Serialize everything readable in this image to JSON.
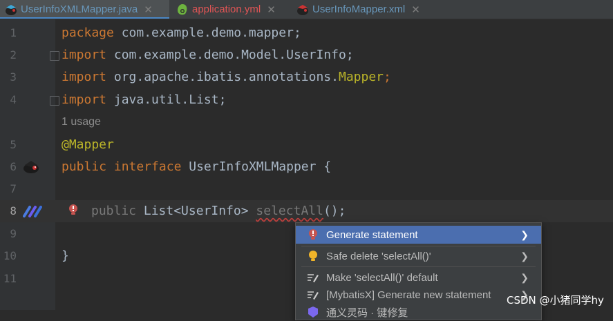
{
  "tabs": [
    {
      "label": "UserInfoXMLMapper.java",
      "icon": "mybatis-java-icon",
      "color": "#6897bb",
      "active": true
    },
    {
      "label": "application.yml",
      "icon": "spring-yml-icon",
      "color": "#e05555",
      "active": false
    },
    {
      "label": "UserInfoMapper.xml",
      "icon": "mybatis-xml-icon",
      "color": "#6897bb",
      "active": false
    }
  ],
  "close_glyph": "✕",
  "line_numbers": [
    "1",
    "2",
    "3",
    "4",
    "5",
    "6",
    "7",
    "8",
    "9",
    "10",
    "11"
  ],
  "code": {
    "l1_kw": "package",
    "l1_rest": " com.example.demo.mapper;",
    "l2_kw": "import",
    "l2_rest": " com.example.demo.Model.UserInfo;",
    "l3_kw": "import",
    "l3_rest": " org.apache.ibatis.annotations.",
    "l3_ann": "Mapper",
    "l3_end": ";",
    "l4_kw": "import",
    "l4_rest": " java.util.List;",
    "usage_hint": "1 usage",
    "l5_ann": "@Mapper",
    "l6_kw1": "public",
    "l6_kw2": " interface",
    "l6_rest": " UserInfoXMLMapper {",
    "l8_kw": "public",
    "l8_type": " List<UserInfo> ",
    "l8_method": "selectAll",
    "l8_end": "();",
    "l10": "}"
  },
  "popup": {
    "items": [
      {
        "label": "Generate statement",
        "icon": "error-bulb-icon",
        "selected": true
      },
      {
        "label": "Safe delete 'selectAll()'",
        "icon": "lightbulb-icon",
        "selected": false
      },
      {
        "label": "Make 'selectAll()' default",
        "icon": "edit-action-icon",
        "selected": false
      },
      {
        "label": "[MybatisX] Generate new statement",
        "icon": "edit-action-icon",
        "selected": false
      },
      {
        "label": "通义灵码 · 键修复",
        "icon": "tongyi-icon",
        "selected": false
      }
    ],
    "arrow": "❯"
  },
  "watermark": "CSDN @小猪同学hy",
  "colors": {
    "keyword": "#cc7832",
    "annotation": "#bbb529",
    "text": "#a9b7c6",
    "selection": "#4b6eaf"
  }
}
